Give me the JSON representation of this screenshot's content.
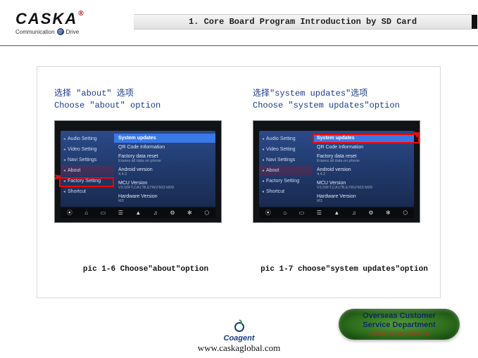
{
  "header": {
    "logo_main": "CASKA",
    "logo_reg": "®",
    "logo_sub_left": "Communication",
    "logo_sub_right": "Drive",
    "title": "1.  Core Board Program Introduction by SD Card"
  },
  "left": {
    "instr_cn": "选择 \"about\" 选项",
    "instr_en": "Choose \"about\" option",
    "caption": "pic 1-6 Choose\"about\"option",
    "sidebar": [
      "Audio Setting",
      "Video Setting",
      "Navi Settings",
      "About",
      "Factory Setting",
      "Shortcut"
    ],
    "main_items": [
      {
        "t": "System updates",
        "hl": true
      },
      {
        "t": "QR Code Information"
      },
      {
        "t": "Factory data reset",
        "s": "Erases all data on phone"
      },
      {
        "t": "Android version",
        "s": "4.4.2"
      },
      {
        "t": "MCU Version",
        "s": "V3.00FT,CA17B,E7W,F503 M09"
      },
      {
        "t": "Hardware Version",
        "s": "M3"
      }
    ]
  },
  "right": {
    "instr_cn": "选择\"system updates\"选项",
    "instr_en": "Choose \"system updates\"option",
    "caption": "pic 1-7 choose\"system updates\"option",
    "sidebar": [
      "Audio Setting",
      "Video Setting",
      "Navi Settings",
      "About",
      "Factory Setting",
      "Shortcut"
    ],
    "main_items": [
      {
        "t": "System updates",
        "hl": true
      },
      {
        "t": "QR Code Information"
      },
      {
        "t": "Factory data reset",
        "s": "Erases all data on phone"
      },
      {
        "t": "Android version",
        "s": "4.4.2"
      },
      {
        "t": "MCU Version",
        "s": "V3.00FT,CA17B,E7W,F503 M09"
      },
      {
        "t": "Hardware Version",
        "s": "M3"
      }
    ]
  },
  "footer": {
    "coagent": "Coagent",
    "url": "www.caskaglobal.com",
    "badge_l1a": "Overseas Customer",
    "badge_l1b": "Service Department",
    "badge_l2": "Service for you sincerely"
  },
  "dock_icons": [
    "⦿",
    "⌂",
    "▭",
    "☰",
    "▲",
    "♫",
    "⚙",
    "✻",
    "⬡"
  ]
}
